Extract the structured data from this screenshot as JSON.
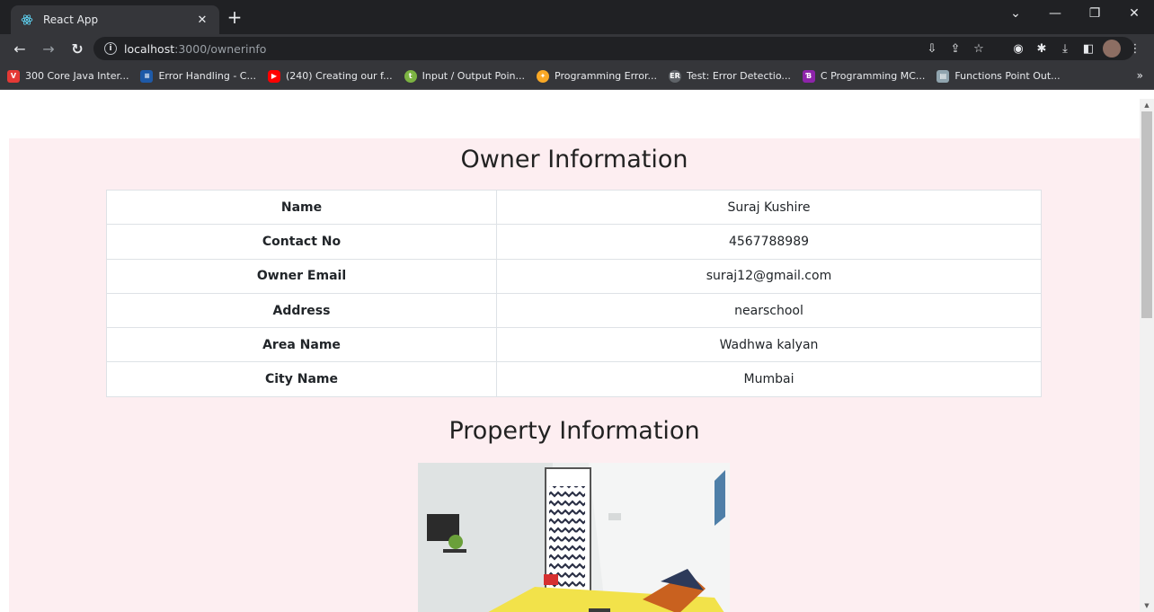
{
  "browser": {
    "tab_title": "React App",
    "url_host": "localhost",
    "url_path": ":3000/ownerinfo",
    "bookmarks": [
      {
        "label": "300 Core Java Inter...",
        "icon": "v-red-icon",
        "color": "#e53935"
      },
      {
        "label": "Error Handling - C...",
        "icon": "codeforwin-icon",
        "color": "#1e5aa8"
      },
      {
        "label": "(240) Creating our f...",
        "icon": "youtube-icon",
        "color": "#ff0000"
      },
      {
        "label": "Input / Output Poin...",
        "icon": "tutorialspoint-icon",
        "color": "#7cb342"
      },
      {
        "label": "Programming Error...",
        "icon": "bug-icon",
        "color": "#f9a825"
      },
      {
        "label": "Test: Error Detectio...",
        "icon": "er-icon",
        "color": "#5f6368"
      },
      {
        "label": "C Programming MC...",
        "icon": "mcq-icon",
        "color": "#8e24aa"
      },
      {
        "label": "Functions Point Out...",
        "icon": "indiabix-icon",
        "color": "#90a4ae"
      }
    ]
  },
  "page": {
    "owner_heading": "Owner Information",
    "property_heading": "Property Information",
    "owner_rows": [
      {
        "label": "Name",
        "value": "Suraj Kushire"
      },
      {
        "label": "Contact No",
        "value": "4567788989"
      },
      {
        "label": "Owner Email",
        "value": "suraj12@gmail.com"
      },
      {
        "label": "Address",
        "value": "nearschool"
      },
      {
        "label": "Area Name",
        "value": "Wadhwa kalyan"
      },
      {
        "label": "City Name",
        "value": "Mumbai"
      }
    ]
  },
  "colors": {
    "page_background": "#fdeef1",
    "chrome_dark": "#202124",
    "chrome_toolbar": "#35363a"
  }
}
